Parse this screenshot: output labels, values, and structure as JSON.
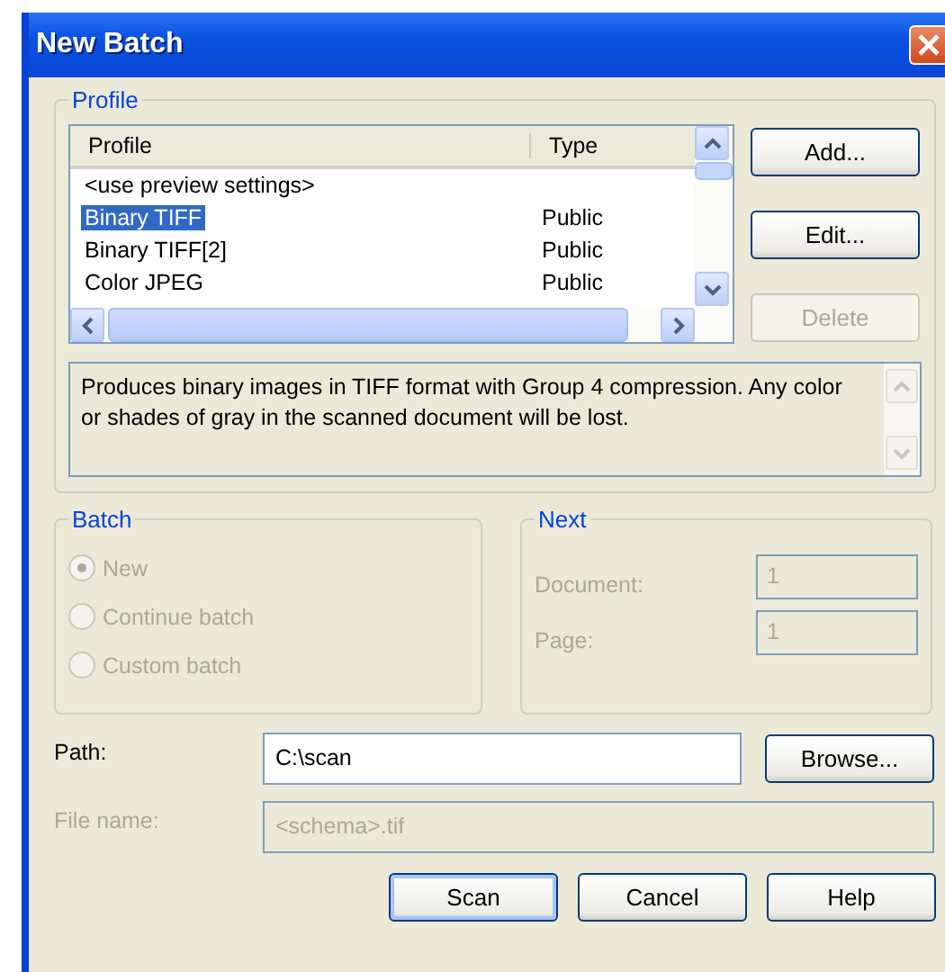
{
  "window": {
    "title": "New Batch"
  },
  "profile_group": {
    "label": "Profile",
    "columns": [
      "Profile",
      "Type"
    ],
    "rows": [
      {
        "name": "<use preview settings>",
        "selected": false
      },
      {
        "name": "Binary TIFF",
        "type": "Public",
        "selected": true
      },
      {
        "name": "Binary TIFF[2]",
        "type": "Public",
        "selected": false
      },
      {
        "name": "Color JPEG",
        "type": "Public",
        "selected": false
      }
    ],
    "buttons": [
      {
        "label": "Add...",
        "disabled": false
      },
      {
        "label": "Edit...",
        "disabled": false
      },
      {
        "label": "Delete",
        "disabled": true
      }
    ],
    "description": "Produces binary images in TIFF format with Group 4 compression. Any color or shades of gray in the scanned document will be lost."
  },
  "batch": {
    "label": "Batch",
    "disabled": true,
    "options": [
      {
        "label": "New",
        "selected": true
      },
      {
        "label": "Continue batch",
        "selected": false
      },
      {
        "label": "Custom batch",
        "selected": false
      }
    ]
  },
  "next": {
    "label": "Next",
    "disabled": true,
    "fields": [
      {
        "label": "Document:",
        "value": "1"
      },
      {
        "label": "Page:",
        "value": "1"
      }
    ]
  },
  "path": {
    "label": "Path:",
    "value": "C:\\scan",
    "button": "Browse..."
  },
  "file_name": {
    "label": "File name:",
    "value": "<schema>.tif",
    "disabled": true
  },
  "buttons": [
    {
      "label": "Scan",
      "default": true
    },
    {
      "label": "Cancel",
      "default": false
    },
    {
      "label": "Help",
      "default": false
    }
  ]
}
